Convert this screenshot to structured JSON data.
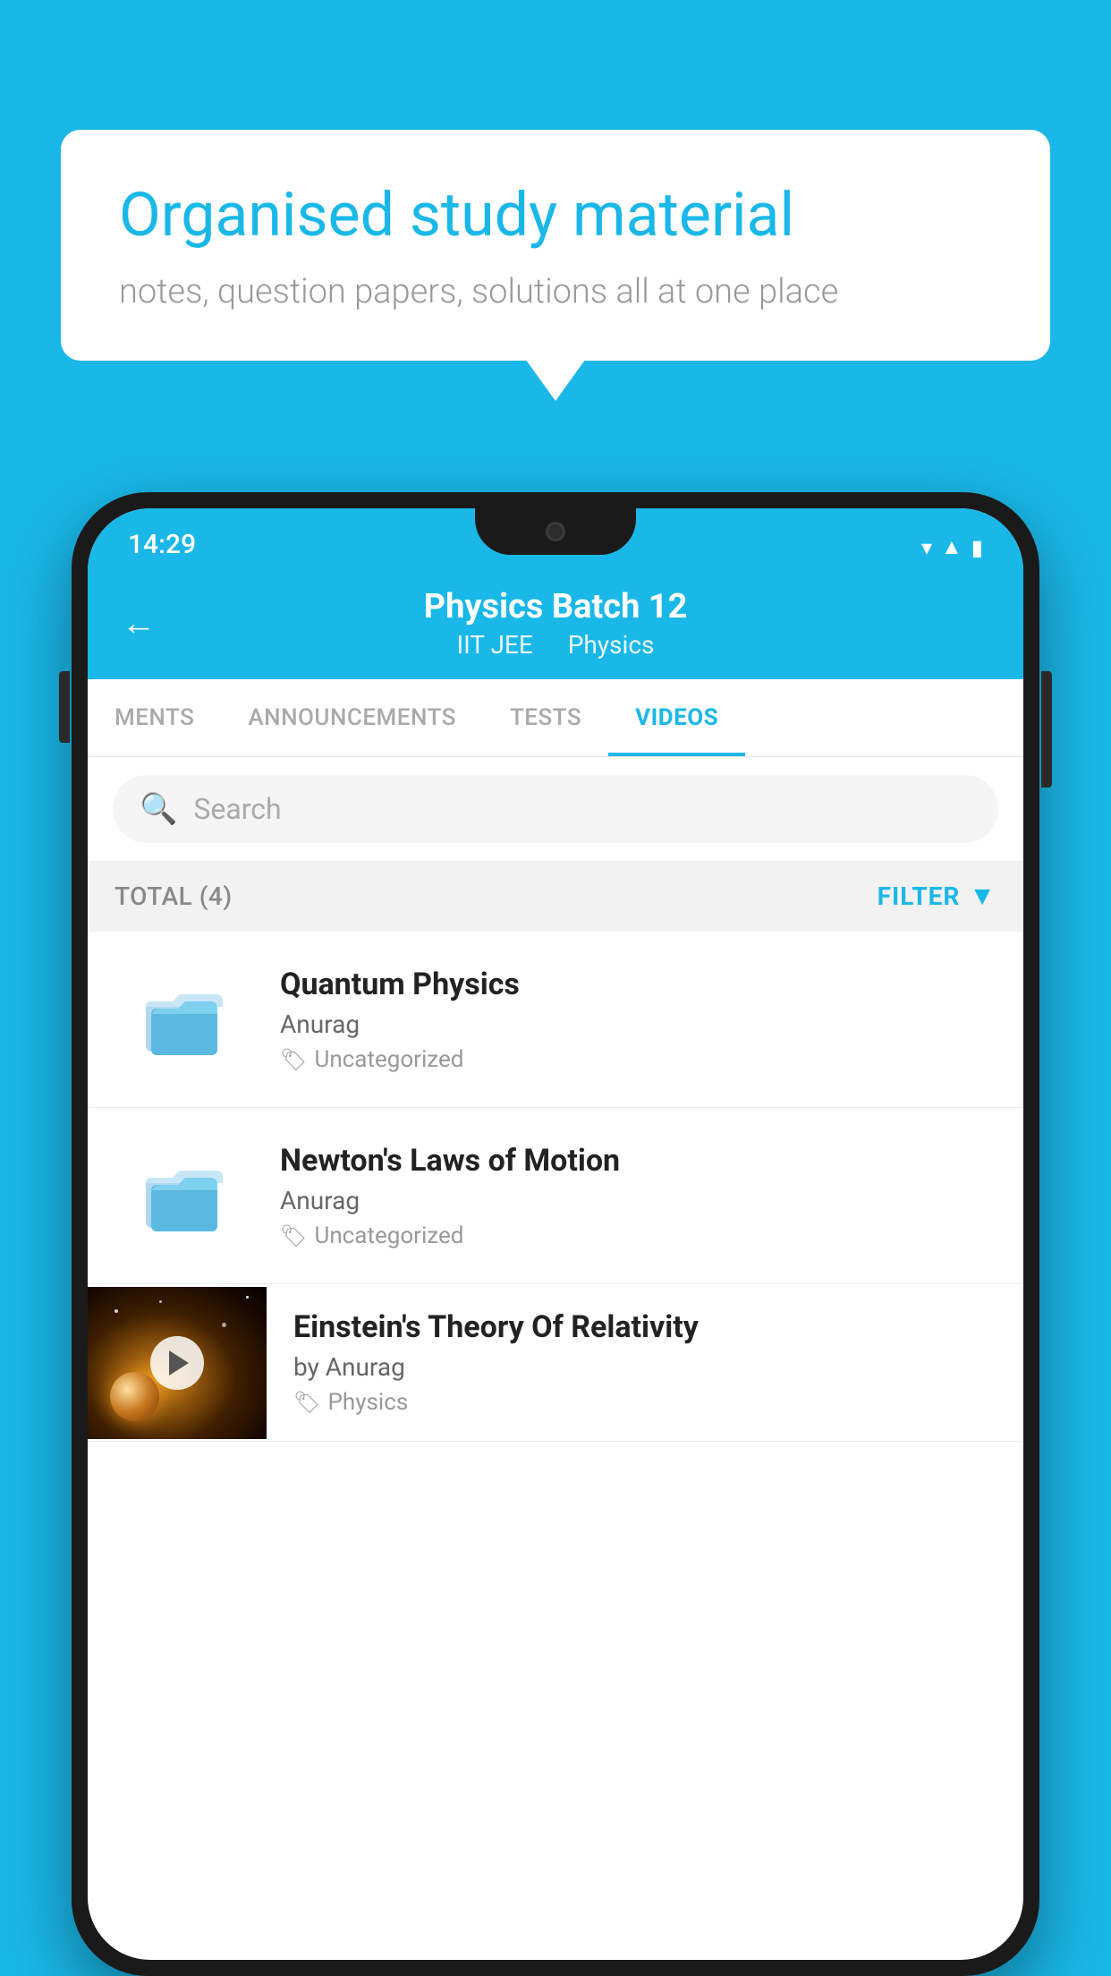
{
  "background": {
    "color": "#1ab8e8"
  },
  "speech_bubble": {
    "title": "Organised study material",
    "subtitle": "notes, question papers, solutions all at one place"
  },
  "phone": {
    "status_bar": {
      "time": "14:29"
    },
    "header": {
      "back_label": "←",
      "title": "Physics Batch 12",
      "subtitle_part1": "IIT JEE",
      "subtitle_part2": "Physics"
    },
    "tabs": [
      {
        "label": "MENTS",
        "active": false
      },
      {
        "label": "ANNOUNCEMENTS",
        "active": false
      },
      {
        "label": "TESTS",
        "active": false
      },
      {
        "label": "VIDEOS",
        "active": true
      }
    ],
    "search": {
      "placeholder": "Search"
    },
    "filter_bar": {
      "total_label": "TOTAL (4)",
      "filter_label": "FILTER"
    },
    "videos": [
      {
        "id": 1,
        "title": "Quantum Physics",
        "author": "Anurag",
        "tag": "Uncategorized",
        "type": "folder"
      },
      {
        "id": 2,
        "title": "Newton's Laws of Motion",
        "author": "Anurag",
        "tag": "Uncategorized",
        "type": "folder"
      },
      {
        "id": 3,
        "title": "Einstein's Theory Of Relativity",
        "author": "by Anurag",
        "tag": "Physics",
        "type": "thumbnail"
      }
    ]
  }
}
